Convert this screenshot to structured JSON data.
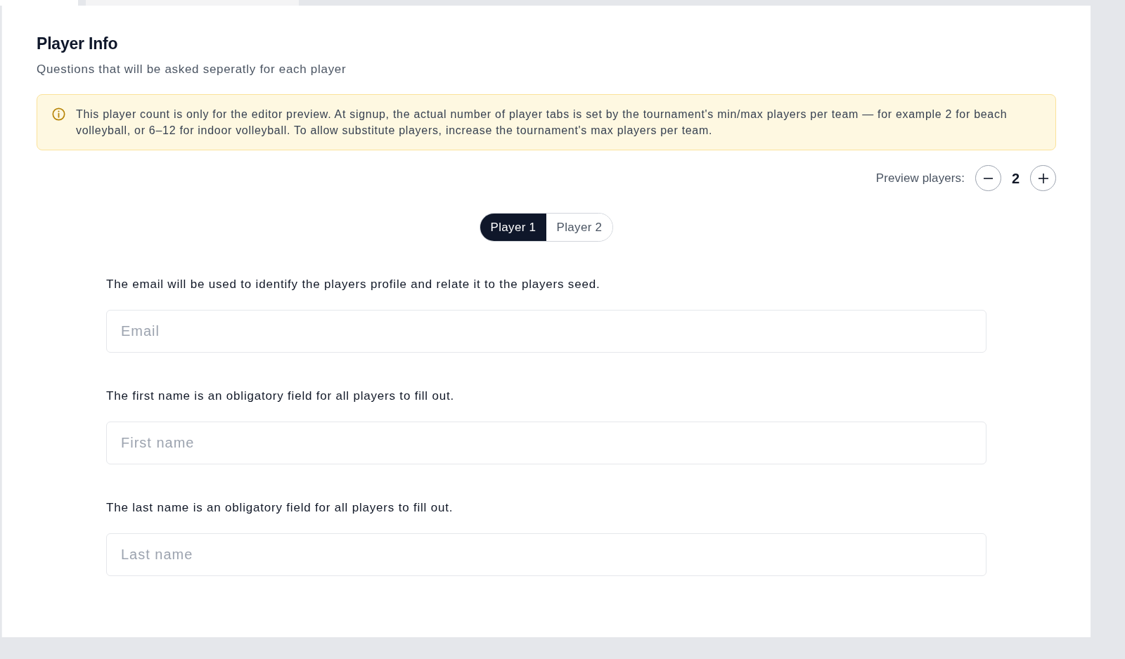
{
  "section": {
    "title": "Player Info",
    "subtitle": "Questions that will be asked seperatly for each player"
  },
  "notice": {
    "text": "This player count is only for the editor preview. At signup, the actual number of player tabs is set by the tournament's min/max players per team — for example 2 for beach volleyball, or 6–12 for indoor volleyball. To allow substitute players, increase the tournament's max players per team."
  },
  "preview_players": {
    "label": "Preview players:",
    "count": "2"
  },
  "player_tabs": [
    {
      "label": "Player 1",
      "selected": true
    },
    {
      "label": "Player 2",
      "selected": false
    }
  ],
  "questions": [
    {
      "description": "The email will be used to identify the players profile and relate it to the players seed.",
      "placeholder": "Email"
    },
    {
      "description": "The first name is an obligatory field for all players to fill out.",
      "placeholder": "First name"
    },
    {
      "description": "The last name is an obligatory field for all players to fill out.",
      "placeholder": "Last name"
    }
  ]
}
